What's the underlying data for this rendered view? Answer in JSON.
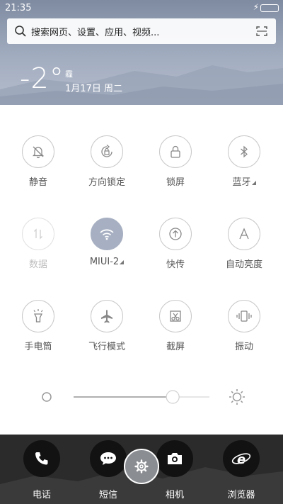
{
  "status": {
    "time": "21:35",
    "charging_icon": "bolt-icon",
    "battery_icon": "battery-icon"
  },
  "search": {
    "placeholder": "搜索网页、设置、应用、视频..."
  },
  "weather": {
    "temperature": "-2°",
    "condition": "霾",
    "date": "1月17日 周二"
  },
  "toggles": [
    {
      "label": "静音",
      "icon": "bell-off-icon",
      "state": "off"
    },
    {
      "label": "方向锁定",
      "icon": "rotation-lock-icon",
      "state": "off"
    },
    {
      "label": "锁屏",
      "icon": "lock-icon",
      "state": "off"
    },
    {
      "label": "蓝牙",
      "icon": "bluetooth-icon",
      "state": "off",
      "has_menu": true
    },
    {
      "label": "数据",
      "icon": "data-icon",
      "state": "disabled"
    },
    {
      "label": "MIUI-2",
      "icon": "wifi-icon",
      "state": "on",
      "has_menu": true
    },
    {
      "label": "快传",
      "icon": "quick-share-icon",
      "state": "off"
    },
    {
      "label": "自动亮度",
      "icon": "auto-brightness-icon",
      "state": "off"
    },
    {
      "label": "手电筒",
      "icon": "flashlight-icon",
      "state": "off"
    },
    {
      "label": "飞行模式",
      "icon": "airplane-icon",
      "state": "off"
    },
    {
      "label": "截屏",
      "icon": "screenshot-icon",
      "state": "off"
    },
    {
      "label": "振动",
      "icon": "vibrate-icon",
      "state": "off"
    }
  ],
  "brightness": {
    "level": 0.73
  },
  "dock": [
    {
      "label": "电话",
      "icon": "phone-icon"
    },
    {
      "label": "短信",
      "icon": "message-icon"
    },
    {
      "label": "相机",
      "icon": "camera-icon"
    },
    {
      "label": "浏览器",
      "icon": "browser-icon"
    }
  ],
  "colors": {
    "accent": "#a7b0c2",
    "header": "#8e99ae"
  }
}
